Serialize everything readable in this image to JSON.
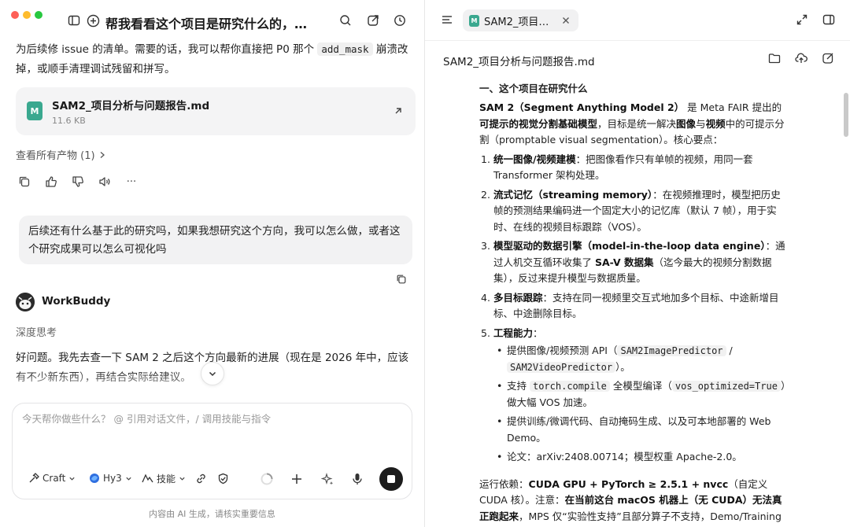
{
  "left": {
    "title": "帮我看看这个项目是研究什么的，有...",
    "prev_text_1": "为后续修 issue 的清单。需要的话，我可以帮你直接把 P0 那个",
    "prev_code": "add_mask",
    "prev_text_2": "崩溃改",
    "prev_text_3": "掉，或顺手清理调试残留和拼写。",
    "file": {
      "name": "SAM2_项目分析与问题报告.md",
      "size": "11.6 KB",
      "icon_letter": "M"
    },
    "artifacts_label": "查看所有产物 (1)",
    "actions": [
      "copy-icon",
      "thumbs-up-icon",
      "thumbs-down-icon",
      "speaker-icon",
      "more-icon"
    ],
    "more_glyph": "···",
    "user_message": "后续还有什么基于此的研究吗，如果我想研究这个方向，我可以怎么做，或者这个研究成果可以怎么可视化吗",
    "bot_name": "WorkBuddy",
    "deep_think": "深度思考",
    "reply": "好问题。我先去查一下 SAM 2 之后这个方向最新的进展（现在是 2026 年中，应该有不少新东西），再结合实际给建议。",
    "composer": {
      "placeholder": "今天帮你做些什么？ @ 引用对话文件，/ 调用技能与指令",
      "craft": "Craft",
      "model": "Hy3",
      "skills": "技能"
    },
    "disclaimer": "内容由 AI 生成，请核实重要信息"
  },
  "right": {
    "tab_label": "SAM2_项目分...",
    "tab_icon_letter": "M",
    "doc_title": "SAM2_项目分析与问题报告.md",
    "section_title": "一、这个项目在研究什么",
    "intro_1": "SAM 2（Segment Anything Model 2）",
    "intro_2": " 是 Meta FAIR 提出的",
    "intro_bold_1": "可提示的视觉分割基础模型",
    "intro_3": "，目标是统一解决",
    "intro_bold_2": "图像",
    "intro_4": "与",
    "intro_bold_3": "视频",
    "intro_5": "中的可提示分割（promptable visual segmentation）。核心要点：",
    "points": [
      {
        "num": "1.",
        "bold": "统一图像/视频建模",
        "text": "：把图像看作只有单帧的视频，用同一套 Transformer 架构处理。"
      },
      {
        "num": "2.",
        "bold": "流式记忆（streaming memory）",
        "text": "：在视频推理时，模型把历史帧的预测结果编码进一个固定大小的记忆库（默认 7 帧），用于实时、在线的视频目标跟踪（VOS）。"
      },
      {
        "num": "3.",
        "bold": "模型驱动的数据引擎（model-in-the-loop data engine）",
        "text": "：通过人机交互循环收集了 ",
        "bold2": "SA-V 数据集",
        "text2": "（迄今最大的视频分割数据集），反过来提升模型与数据质量。"
      },
      {
        "num": "4.",
        "bold": "多目标跟踪",
        "text": "：支持在同一视频里交互式地加多个目标、中途新增目标、中途删除目标。"
      },
      {
        "num": "5.",
        "bold": "工程能力",
        "text": "："
      }
    ],
    "eng": {
      "b1_pre": "提供图像/视频预测 API（",
      "b1_code1": "SAM2ImagePredictor",
      "b1_mid": " / ",
      "b1_code2": "SAM2VideoPredictor",
      "b1_post": "）。",
      "b2_pre": "支持 ",
      "b2_code1": "torch.compile",
      "b2_mid": " 全模型编译（",
      "b2_code2": "vos_optimized=True",
      "b2_post": "）做大幅 VOS 加速。",
      "b3": "提供训练/微调代码、自动掩码生成、以及可本地部署的 Web Demo。",
      "b4": "论文：arXiv:2408.00714；模型权重 Apache-2.0。"
    },
    "deps_pre": "运行依赖：",
    "deps_bold": "CUDA GPU + PyTorch ≥ 2.5.1 + nvcc",
    "deps_post": "（自定义 CUDA 核）。注意：",
    "deps_bold2": "在当前这台 macOS 机器上（无 CUDA）无法真正跑起来",
    "deps_tail": "，MPS 仅“实验性支持”且部分算子不支持，Demo/Training 基本不可"
  }
}
